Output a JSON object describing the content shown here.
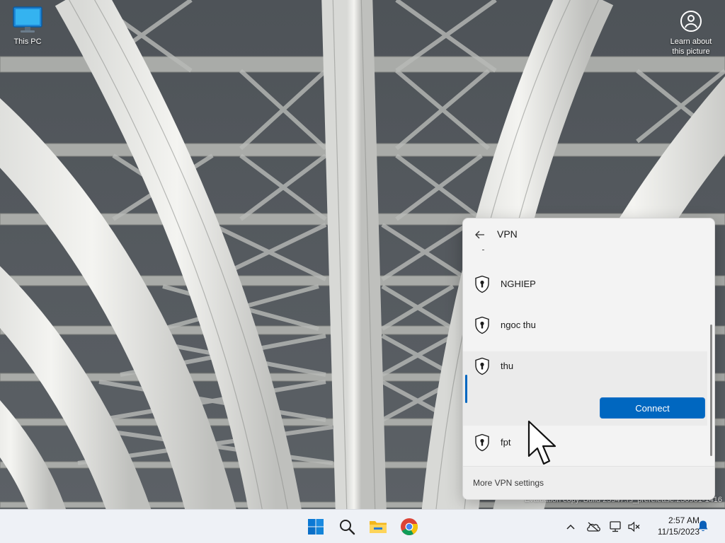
{
  "desktop": {
    "icons": [
      {
        "label": "This PC",
        "icon": "computer-monitor-icon"
      },
      {
        "label": "Learn about this picture",
        "icon": "camera-circle-icon"
      }
    ],
    "watermark": "Evaluation copy. Build 25947.rs_prerelease.230901-1416"
  },
  "vpn_panel": {
    "title": "VPN",
    "connections": [
      {
        "name": "NGHIEP",
        "icon": "shield-lock-icon"
      },
      {
        "name": "ngoc thu",
        "icon": "shield-lock-icon"
      },
      {
        "name": "thu",
        "icon": "shield-lock-icon",
        "expanded": true
      },
      {
        "name": "fpt",
        "icon": "shield-lock-icon"
      }
    ],
    "connect_label": "Connect",
    "more_settings_label": "More VPN settings",
    "colors": {
      "accent": "#0067c0",
      "panel_bg": "#f3f3f3"
    }
  },
  "taskbar": {
    "apps": [
      {
        "name": "Start",
        "icon": "windows-logo-icon"
      },
      {
        "name": "Search",
        "icon": "search-icon"
      },
      {
        "name": "File Explorer",
        "icon": "folder-icon"
      },
      {
        "name": "Google Chrome",
        "icon": "chrome-icon"
      }
    ],
    "tray": {
      "icons": [
        "chevron-up-icon",
        "onedrive-offline-icon",
        "network-icon",
        "volume-muted-icon",
        "notification-bell-icon"
      ]
    },
    "clock": {
      "time": "2:57 AM",
      "date": "11/15/2023"
    }
  }
}
